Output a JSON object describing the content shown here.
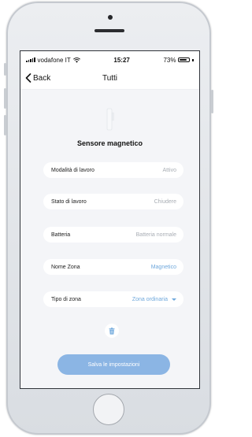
{
  "status": {
    "carrier": "vodafone IT",
    "time": "15:27",
    "battery": "73%",
    "battery_level": 0.73,
    "wifi_icon": "wifi-icon"
  },
  "nav": {
    "back_label": "Back",
    "title": "Tutti"
  },
  "device": {
    "name": "Sensore magnetico",
    "image_icon": "magnetic-sensor-icon"
  },
  "settings": [
    {
      "label": "Modalità di lavoro",
      "value": "Attivo"
    },
    {
      "label": "Stato di lavoro",
      "value": "Chiudere"
    },
    {
      "label": "Batteria",
      "value": "Batteria normale"
    },
    {
      "label": "Nome Zona",
      "value": "Magnetico"
    },
    {
      "label": "Tipo di zona",
      "value": "Zona ordinaria"
    }
  ],
  "actions": {
    "delete_icon": "trash-icon",
    "save_label": "Salva le impostazioni"
  },
  "colors": {
    "accent": "#6fa8dc",
    "save_button": "#8bb5e4",
    "background": "#f4f5f8"
  }
}
